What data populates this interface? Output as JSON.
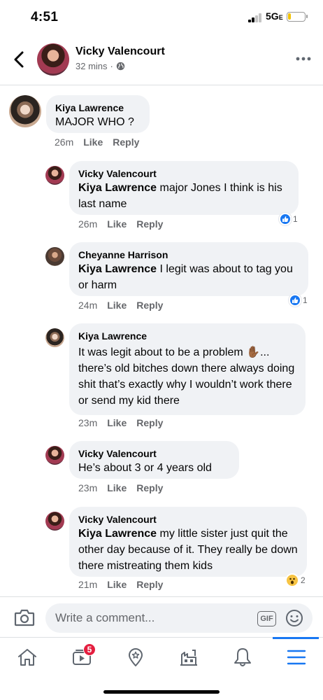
{
  "status_bar": {
    "time": "4:51",
    "network": "5G",
    "network_suffix": "E"
  },
  "header": {
    "back_icon": "chevron-left-icon",
    "name": "Vicky Valencourt",
    "time": "32 mins",
    "separator": "·",
    "privacy_icon": "globe-icon",
    "more_icon": "more-icon"
  },
  "comments": [
    {
      "author": "Kiya Lawrence",
      "tag": "",
      "text": "MAJOR WHO ?",
      "time": "26m",
      "like": "Like",
      "reply": "Reply",
      "reaction": null
    },
    {
      "author": "Vicky Valencourt",
      "tag": "Kiya Lawrence",
      "text": " major Jones I think is his last name",
      "time": "26m",
      "like": "Like",
      "reply": "Reply",
      "reaction": {
        "type": "like",
        "count": "1"
      }
    },
    {
      "author": "Cheyanne Harrison",
      "tag": "Kiya Lawrence",
      "text": " I legit was about to tag you or harm",
      "time": "24m",
      "like": "Like",
      "reply": "Reply",
      "reaction": {
        "type": "like",
        "count": "1"
      }
    },
    {
      "author": "Kiya Lawrence",
      "tag": "",
      "text": "It was legit about to be a problem ✋🏾... there’s old bitches down there always doing shit that’s exactly why I wouldn’t work there or send my kid there",
      "time": "23m",
      "like": "Like",
      "reply": "Reply",
      "reaction": null
    },
    {
      "author": "Vicky Valencourt",
      "tag": "",
      "text": "He’s about 3 or 4 years old",
      "time": "23m",
      "like": "Like",
      "reply": "Reply",
      "reaction": null
    },
    {
      "author": "Vicky Valencourt",
      "tag": "Kiya Lawrence",
      "text": " my little sister just quit the other day because of it. They really be down there mistreating them kids",
      "time": "21m",
      "like": "Like",
      "reply": "Reply",
      "reaction": {
        "type": "wow",
        "count": "2"
      }
    }
  ],
  "composer": {
    "placeholder": "Write a comment...",
    "gif_label": "GIF"
  },
  "tabbar": {
    "items": [
      "home-icon",
      "watch-icon",
      "pages-icon",
      "marketplace-icon",
      "notifications-icon",
      "menu-icon"
    ],
    "watch_badge": "5"
  },
  "colors": {
    "accent": "#1877f2",
    "bubble": "#f0f2f5",
    "badge": "#e41e3f"
  }
}
